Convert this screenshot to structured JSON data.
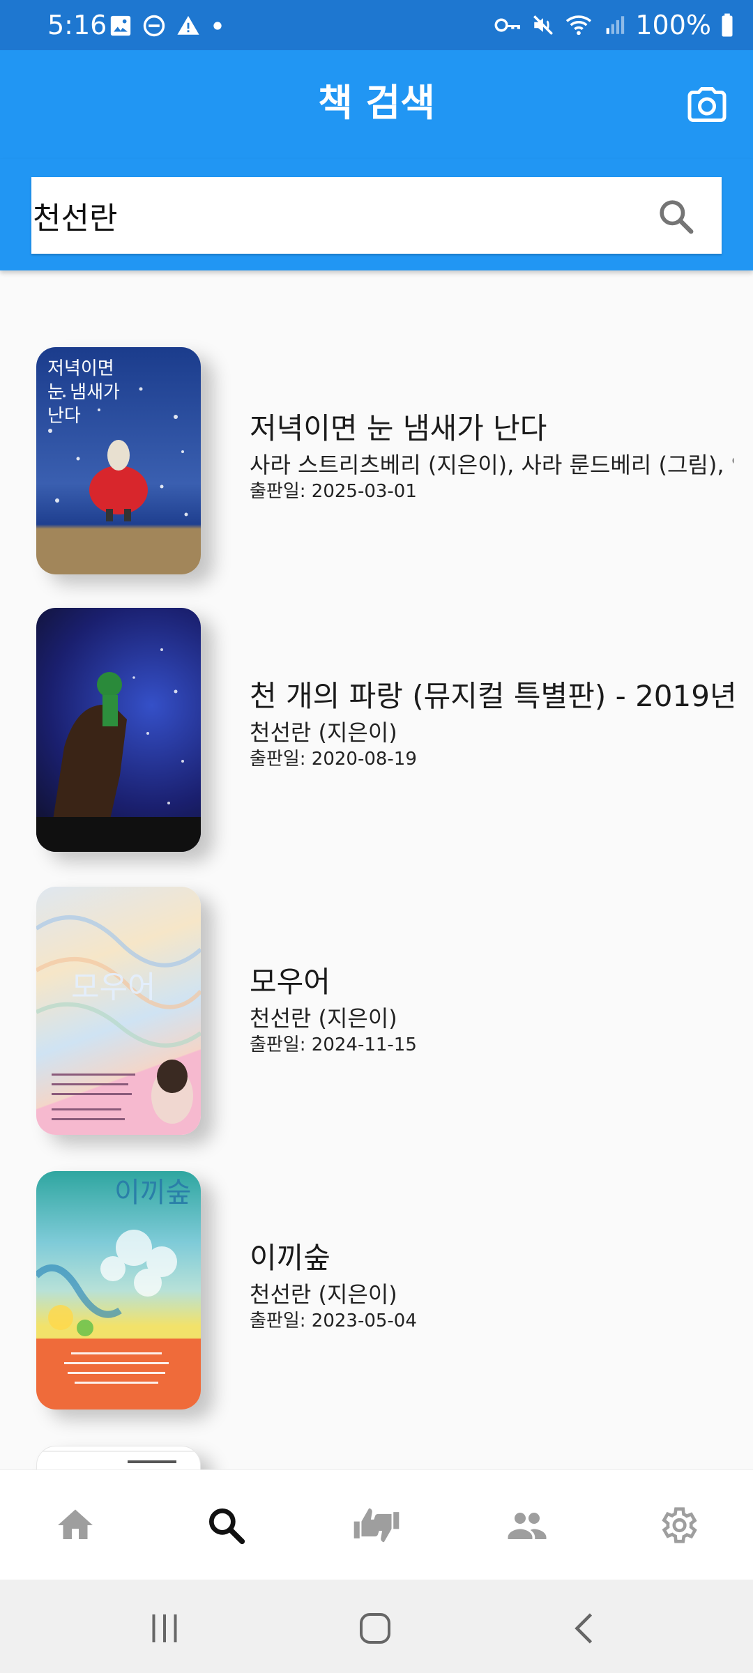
{
  "status_bar": {
    "time": "5:16",
    "battery": "100%"
  },
  "app_bar": {
    "title": "책 검색",
    "camera_icon": "camera-icon"
  },
  "search": {
    "value": "천선란",
    "icon": "search-icon"
  },
  "books": [
    {
      "title": "저녁이면 눈 냄새가 난다",
      "author": "사라 스트리츠베리 (지은이), 사라 룬드베리 (그림), 안",
      "date": "출판일: 2025-03-01",
      "cover_text": "저녁이면 눈 냄새가 난다",
      "cover_colors": [
        "#1b3c8c",
        "#3a5fb0",
        "#a2865a"
      ]
    },
    {
      "title": "천 개의 파랑 (뮤지컬 특별판) - 2019년",
      "author": "천선란 (지은이)",
      "date": "출판일: 2020-08-19",
      "cover_text": "",
      "cover_colors": [
        "#1a1f6e",
        "#2b3fb0",
        "#0d0d1c"
      ]
    },
    {
      "title": "모우어",
      "author": "천선란 (지은이)",
      "date": "출판일: 2024-11-15",
      "cover_text": "모우어",
      "cover_colors": [
        "#dfe7f0",
        "#f3d6c9",
        "#f6b9cf"
      ]
    },
    {
      "title": "이끼숲",
      "author": "천선란 (지은이)",
      "date": "출판일: 2023-05-04",
      "cover_text": "이끼숲",
      "cover_colors": [
        "#2fa6a0",
        "#b7e1d8",
        "#ef6b3a"
      ]
    }
  ],
  "bottom_nav": [
    {
      "name": "home",
      "icon": "home-icon",
      "active": false
    },
    {
      "name": "search",
      "icon": "search-icon",
      "active": true
    },
    {
      "name": "recommend",
      "icon": "thumbs-icon",
      "active": false
    },
    {
      "name": "friends",
      "icon": "people-icon",
      "active": false
    },
    {
      "name": "settings",
      "icon": "gear-icon",
      "active": false
    }
  ],
  "colors": {
    "primary": "#2196f3",
    "status_bar": "#1e77d0",
    "nav_inactive": "#9e9e9e",
    "nav_active": "#111111"
  }
}
